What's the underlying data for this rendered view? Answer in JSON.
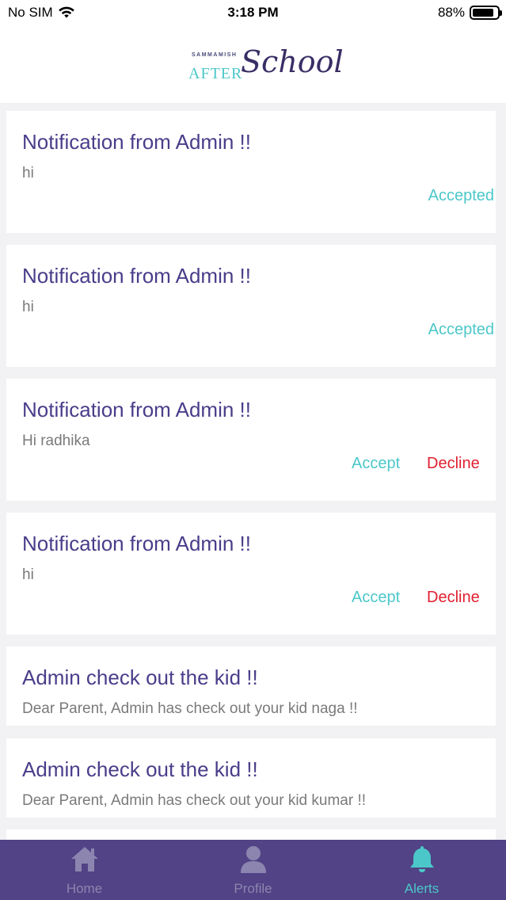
{
  "status_bar": {
    "carrier": "No SIM",
    "time": "3:18 PM",
    "battery": "88%",
    "battery_level": 0.88,
    "icons": [
      "wifi-icon",
      "battery-icon"
    ]
  },
  "header": {
    "logo_small": "SAMMAMISH",
    "logo_after": "AFTER",
    "logo_school": "School"
  },
  "notifications": [
    {
      "title": "Notification from Admin !!",
      "message": "hi",
      "status": "Accepted"
    },
    {
      "title": "Notification from Admin !!",
      "message": "hi",
      "status": "Accepted"
    },
    {
      "title": "Notification from Admin !!",
      "message": "Hi radhika",
      "accept_label": "Accept",
      "decline_label": "Decline"
    },
    {
      "title": "Notification from Admin !!",
      "message": "hi",
      "accept_label": "Accept",
      "decline_label": "Decline"
    },
    {
      "title": "Admin check out the kid !!",
      "message": "Dear Parent, Admin has check out your kid naga !!"
    },
    {
      "title": "Admin check out the kid !!",
      "message": "Dear Parent, Admin has check out your kid kumar !!"
    }
  ],
  "tabbar": {
    "tabs": [
      {
        "label": "Home",
        "icon": "home-icon",
        "active": false
      },
      {
        "label": "Profile",
        "icon": "profile-icon",
        "active": false
      },
      {
        "label": "Alerts",
        "icon": "bell-icon",
        "active": true
      }
    ]
  },
  "colors": {
    "primary_purple": "#514385",
    "title_purple": "#4a3d8a",
    "accent_teal": "#4cc7c9",
    "decline_red": "#e02030",
    "background": "#f2f2f4"
  }
}
